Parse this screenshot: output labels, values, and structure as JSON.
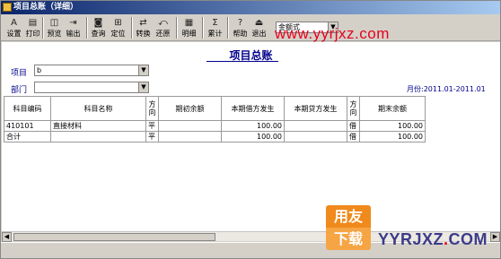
{
  "window": {
    "title": "项目总账（详细）"
  },
  "toolbar": {
    "buttons": [
      {
        "label": "设置",
        "icon": "settings-icon",
        "glyph": "A"
      },
      {
        "label": "打印",
        "icon": "print-icon",
        "glyph": "▤"
      },
      {
        "label": "预览",
        "icon": "preview-icon",
        "glyph": "◫"
      },
      {
        "label": "输出",
        "icon": "export-icon",
        "glyph": "⇥"
      },
      {
        "label": "查询",
        "icon": "query-icon",
        "glyph": "◙"
      },
      {
        "label": "定位",
        "icon": "locate-icon",
        "glyph": "⊞"
      },
      {
        "label": "转换",
        "icon": "convert-icon",
        "glyph": "⇄"
      },
      {
        "label": "还原",
        "icon": "restore-icon",
        "glyph": "⤺"
      },
      {
        "label": "明细",
        "icon": "detail-icon",
        "glyph": "▦"
      },
      {
        "label": "累计",
        "icon": "sum-icon",
        "glyph": "Σ"
      },
      {
        "label": "帮助",
        "icon": "help-icon",
        "glyph": "?"
      },
      {
        "label": "退出",
        "icon": "exit-icon",
        "glyph": "⏏"
      }
    ],
    "format_select": "金额式"
  },
  "watermark": {
    "url_top": "www.yyrjxz.com",
    "badge_top": "用友",
    "badge_bottom": "下载",
    "url_bottom_a": "YYRJXZ",
    "url_bottom_dot": ".",
    "url_bottom_b": "COM"
  },
  "report": {
    "title": "项目总账",
    "project_label": "项目",
    "project_value": "b",
    "department_label": "部门",
    "department_value": "",
    "month_label": "月份:2011.01-2011.01",
    "columns": [
      "科目编码",
      "科目名称",
      "方向",
      "期初余额",
      "本期借方发生",
      "本期贷方发生",
      "方向",
      "期末余额"
    ],
    "rows": [
      [
        "410101",
        "直接材料",
        "平",
        "",
        "100.00",
        "",
        "借",
        "100.00"
      ],
      [
        "合计",
        "",
        "平",
        "",
        "100.00",
        "",
        "借",
        "100.00"
      ]
    ]
  }
}
